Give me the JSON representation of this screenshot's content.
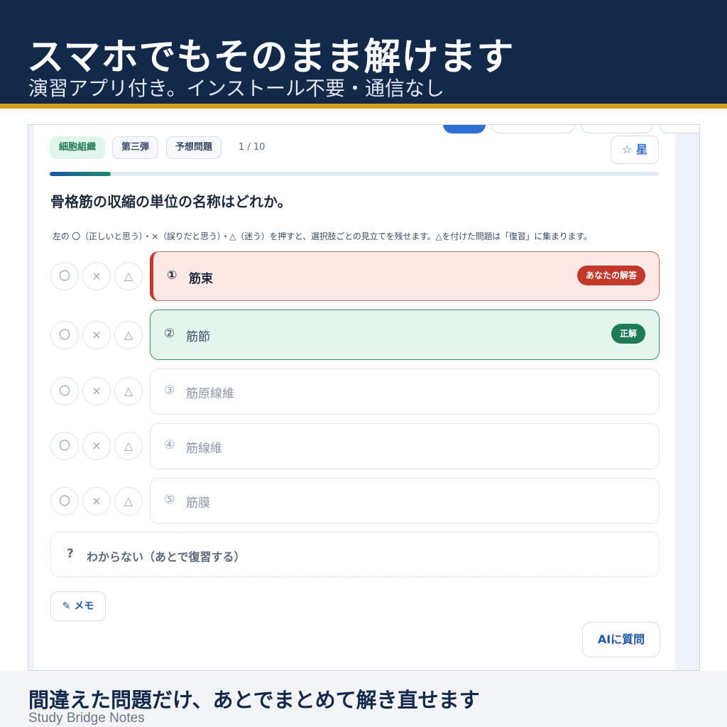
{
  "banner": {
    "title": "スマホでもそのまま解けます",
    "subtitle": "演習アプリ付き。インストール不要・通信なし"
  },
  "app": {
    "chips": [
      "細胞組織",
      "第三弾",
      "予想問題"
    ],
    "counter": "1 / 10",
    "star_label": "☆ 星",
    "progress": 0.1,
    "question": "骨格筋の収縮の単位の名称はどれか。",
    "instruction": "左の 〇（正しいと思う）・×（誤りだと思う）・△（迷う）を押すと、選択肢ごとの見立てを残せます。△を付けた問題は「復習」に集まります。",
    "mark_buttons": [
      "〇",
      "×",
      "△"
    ],
    "options": [
      {
        "num": "①",
        "text": "筋束",
        "state": "your-answer",
        "badge": "あなたの解答"
      },
      {
        "num": "②",
        "text": "筋節",
        "state": "correct",
        "badge": "正解"
      },
      {
        "num": "③",
        "text": "筋原線維",
        "state": "neutral",
        "badge": ""
      },
      {
        "num": "④",
        "text": "筋線維",
        "state": "neutral",
        "badge": ""
      },
      {
        "num": "⑤",
        "text": "筋膜",
        "state": "neutral",
        "badge": ""
      }
    ],
    "unknown": {
      "icon": "?",
      "label": "わからない（あとで復習する）"
    },
    "memo_label": "✎ メモ",
    "ai_label": "AIに質問"
  },
  "footer": {
    "title": "間違えた問題だけ、あとでまとめて解き直せます",
    "brand": "Study Bridge Notes"
  },
  "colors": {
    "banner_bg": "#13294a",
    "accent_gold": "#d4a021",
    "wrong_red": "#c0392b",
    "correct_green": "#1f7a57",
    "primary_blue": "#2f6fd1"
  }
}
